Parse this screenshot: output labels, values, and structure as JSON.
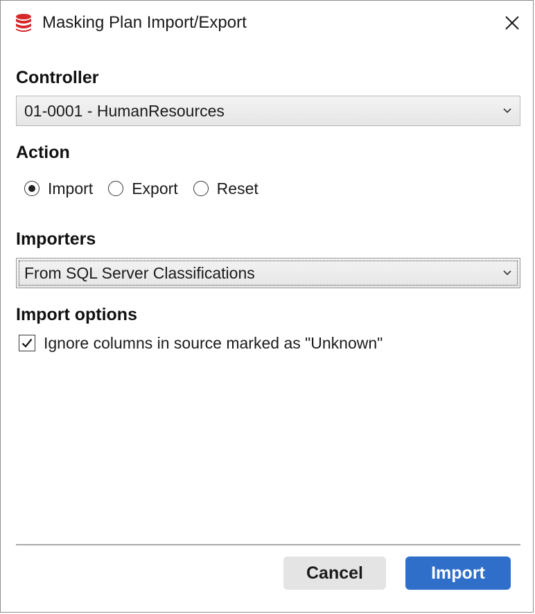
{
  "window": {
    "title": "Masking Plan Import/Export",
    "app_icon": "database-stack-icon",
    "close_icon": "close-icon"
  },
  "controller": {
    "label": "Controller",
    "selected": "01-0001 - HumanResources"
  },
  "action": {
    "label": "Action",
    "options": [
      {
        "label": "Import",
        "checked": true
      },
      {
        "label": "Export",
        "checked": false
      },
      {
        "label": "Reset",
        "checked": false
      }
    ]
  },
  "importers": {
    "label": "Importers",
    "selected": "From SQL Server Classifications"
  },
  "import_options": {
    "label": "Import options",
    "ignore_unknown": {
      "label": "Ignore columns in source marked as \"Unknown\"",
      "checked": true
    }
  },
  "footer": {
    "cancel_label": "Cancel",
    "import_label": "Import"
  },
  "colors": {
    "accent": "#2f6fca",
    "icon_red": "#d4282a"
  }
}
